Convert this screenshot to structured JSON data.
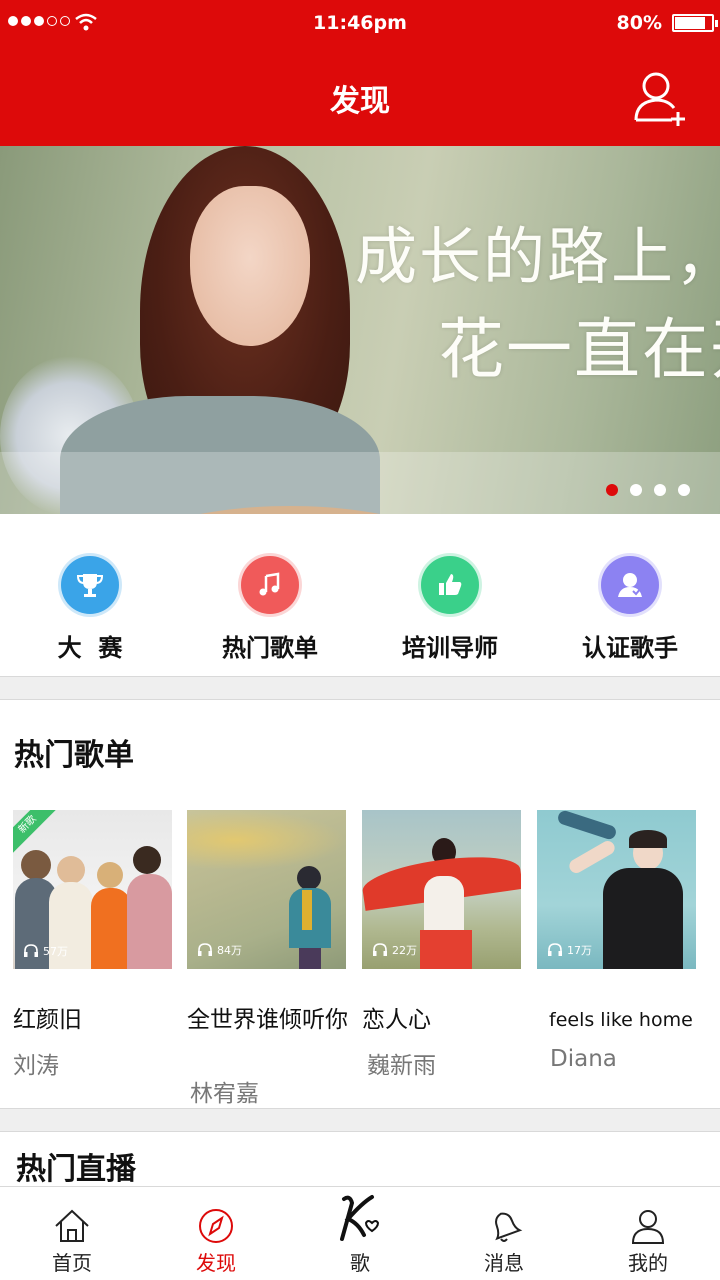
{
  "status_bar": {
    "time": "11:46pm",
    "battery": "80%"
  },
  "header": {
    "title": "发现"
  },
  "banner": {
    "slogan_line1": "成长的路上，",
    "slogan_line2": "花一直在开",
    "slides": 4,
    "active_slide": 1
  },
  "categories": [
    {
      "label": "大  赛",
      "icon": "trophy-icon",
      "color": "#3aa4e8"
    },
    {
      "label": "热门歌单",
      "icon": "music-note-icon",
      "color": "#f05a5a"
    },
    {
      "label": "培训导师",
      "icon": "thumbs-up-icon",
      "color": "#3ad08a"
    },
    {
      "label": "认证歌手",
      "icon": "verified-singer-icon",
      "color": "#8c82f2"
    }
  ],
  "hot_playlists": {
    "title": "热门歌单",
    "items": [
      {
        "name": "红颜旧",
        "artist": "刘涛",
        "plays": "57万",
        "badge": "新歌"
      },
      {
        "name": "全世界谁倾听你",
        "artist": "林宥嘉",
        "plays": "84万"
      },
      {
        "name": "恋人心",
        "artist": "巍新雨",
        "plays": "22万"
      },
      {
        "name": "feels like home",
        "artist": "Diana",
        "plays": "17万"
      }
    ]
  },
  "hot_live": {
    "title": "热门直播"
  },
  "tabbar": {
    "items": [
      {
        "label": "首页",
        "icon": "home-icon"
      },
      {
        "label": "发现",
        "icon": "compass-icon",
        "active": true
      },
      {
        "label": "歌",
        "icon": "k-song-icon"
      },
      {
        "label": "消息",
        "icon": "bell-icon"
      },
      {
        "label": "我的",
        "icon": "user-icon"
      }
    ]
  },
  "colors": {
    "brand_red": "#dd0a0a",
    "muted_text": "#777777"
  }
}
